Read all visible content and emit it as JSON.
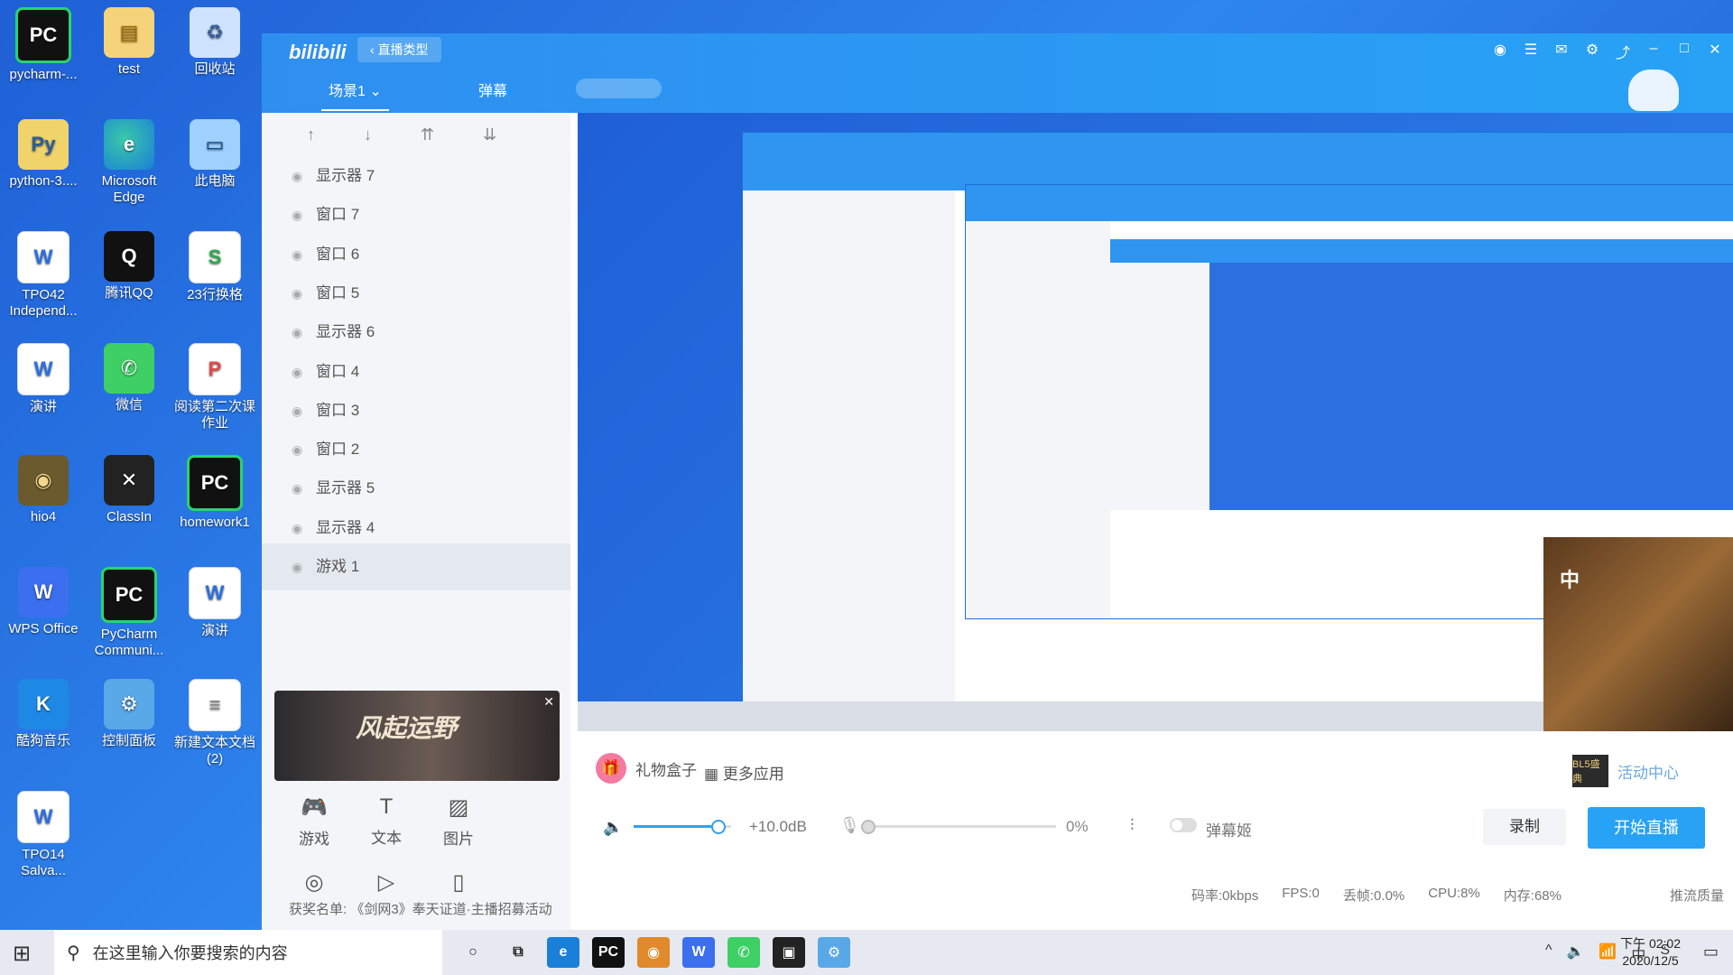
{
  "desktop": {
    "icons": [
      {
        "label": "pycharm-...",
        "glyph": "PC",
        "icon": "pycharm-icon"
      },
      {
        "label": "test",
        "glyph": "▤",
        "icon": "folder-icon"
      },
      {
        "label": "回收站",
        "glyph": "♻",
        "icon": "recycle-bin-icon"
      },
      {
        "label": "python-3....",
        "glyph": "Py",
        "icon": "python-installer-icon"
      },
      {
        "label": "Microsoft Edge",
        "glyph": "e",
        "icon": "edge-icon"
      },
      {
        "label": "此电脑",
        "glyph": "▭",
        "icon": "this-pc-icon"
      },
      {
        "label": "TPO42 Independ...",
        "glyph": "W",
        "icon": "word-doc-icon"
      },
      {
        "label": "腾讯QQ",
        "glyph": "Q",
        "icon": "qq-icon"
      },
      {
        "label": "23行换格",
        "glyph": "S",
        "icon": "spreadsheet-icon"
      },
      {
        "label": "演讲",
        "glyph": "W",
        "icon": "word-doc-icon"
      },
      {
        "label": "微信",
        "glyph": "✆",
        "icon": "wechat-icon"
      },
      {
        "label": "阅读第二次课作业",
        "glyph": "P",
        "icon": "pdf-icon"
      },
      {
        "label": "hio4",
        "glyph": "◉",
        "icon": "hio4-icon"
      },
      {
        "label": "ClassIn",
        "glyph": "✕",
        "icon": "classin-icon"
      },
      {
        "label": "homework1",
        "glyph": "PC",
        "icon": "pycharm-icon"
      },
      {
        "label": "WPS Office",
        "glyph": "W",
        "icon": "wps-icon"
      },
      {
        "label": "PyCharm Communi...",
        "glyph": "PC",
        "icon": "pycharm-icon"
      },
      {
        "label": "演讲",
        "glyph": "W",
        "icon": "word-doc-icon"
      },
      {
        "label": "酷狗音乐",
        "glyph": "K",
        "icon": "kugou-icon"
      },
      {
        "label": "控制面板",
        "glyph": "⚙",
        "icon": "control-panel-icon"
      },
      {
        "label": "新建文本文档 (2)",
        "glyph": "≡",
        "icon": "text-file-icon"
      },
      {
        "label": "TPO14 Salva...",
        "glyph": "W",
        "icon": "word-doc-icon"
      }
    ]
  },
  "app": {
    "logo": "bilibili",
    "type_button": "‹ 直播类型",
    "tabs": {
      "scene": "场景1 ⌄",
      "danmu": "弹幕"
    },
    "titlebar_icons": [
      "avatar-icon",
      "menu-icon",
      "mail-icon",
      "settings-icon",
      "share-icon",
      "minimize-icon",
      "maximize-icon",
      "close-icon"
    ],
    "sort_icons": [
      "↑",
      "↓",
      "⇈",
      "⇊"
    ],
    "sources": [
      {
        "label": "显示器 7"
      },
      {
        "label": "窗口 7"
      },
      {
        "label": "窗口 6"
      },
      {
        "label": "窗口 5"
      },
      {
        "label": "显示器 6"
      },
      {
        "label": "窗口 4"
      },
      {
        "label": "窗口 3"
      },
      {
        "label": "窗口 2"
      },
      {
        "label": "显示器 5"
      },
      {
        "label": "显示器 4"
      },
      {
        "label": "游戏 1"
      }
    ],
    "banner_text": "风起运野",
    "tools": [
      {
        "label": "游戏",
        "glyph": "🎮"
      },
      {
        "label": "文本",
        "glyph": "T"
      },
      {
        "label": "图片",
        "glyph": "▨"
      }
    ],
    "tools2": [
      {
        "glyph": "◎"
      },
      {
        "glyph": "▷"
      },
      {
        "glyph": "▯"
      }
    ],
    "notice": "获奖名单: 《剑网3》奉天证道·主播招募活动",
    "gift_box": "礼物盒子",
    "more_apps": "更多应用",
    "activity_center": "活动中心",
    "activity_badge": "BL5盛典",
    "volume_db": "+10.0dB",
    "volume_level": 0.85,
    "mic_pct": "0%",
    "mic_level": 0,
    "danmu_ji": "弹幕姬",
    "record": "录制",
    "start_live": "开始直播",
    "stats": [
      "码率:0kbps",
      "FPS:0",
      "丢帧:0.0%",
      "CPU:8%",
      "内存:68%"
    ],
    "quality": "推流质量"
  },
  "taskbar": {
    "search_placeholder": "在这里输入你要搜索的内容",
    "apps": [
      {
        "glyph": "○",
        "icon": "cortana-icon"
      },
      {
        "glyph": "⧉",
        "icon": "task-view-icon"
      },
      {
        "glyph": "e",
        "icon": "edge-icon"
      },
      {
        "glyph": "PC",
        "icon": "pycharm-icon"
      },
      {
        "glyph": "◉",
        "icon": "game-icon"
      },
      {
        "glyph": "W",
        "icon": "wps-icon"
      },
      {
        "glyph": "✆",
        "icon": "wechat-icon"
      },
      {
        "glyph": "▣",
        "icon": "app-icon"
      },
      {
        "glyph": "⚙",
        "icon": "control-panel-icon"
      }
    ],
    "tray": [
      "^",
      "🔈",
      "📶",
      "中",
      "S"
    ],
    "time": "下午 02:02",
    "date": "2020/12/5"
  },
  "colors": {
    "accent": "#27a2f5",
    "desktop": "#2f86ee",
    "left_panel": "#f3f5f8"
  }
}
